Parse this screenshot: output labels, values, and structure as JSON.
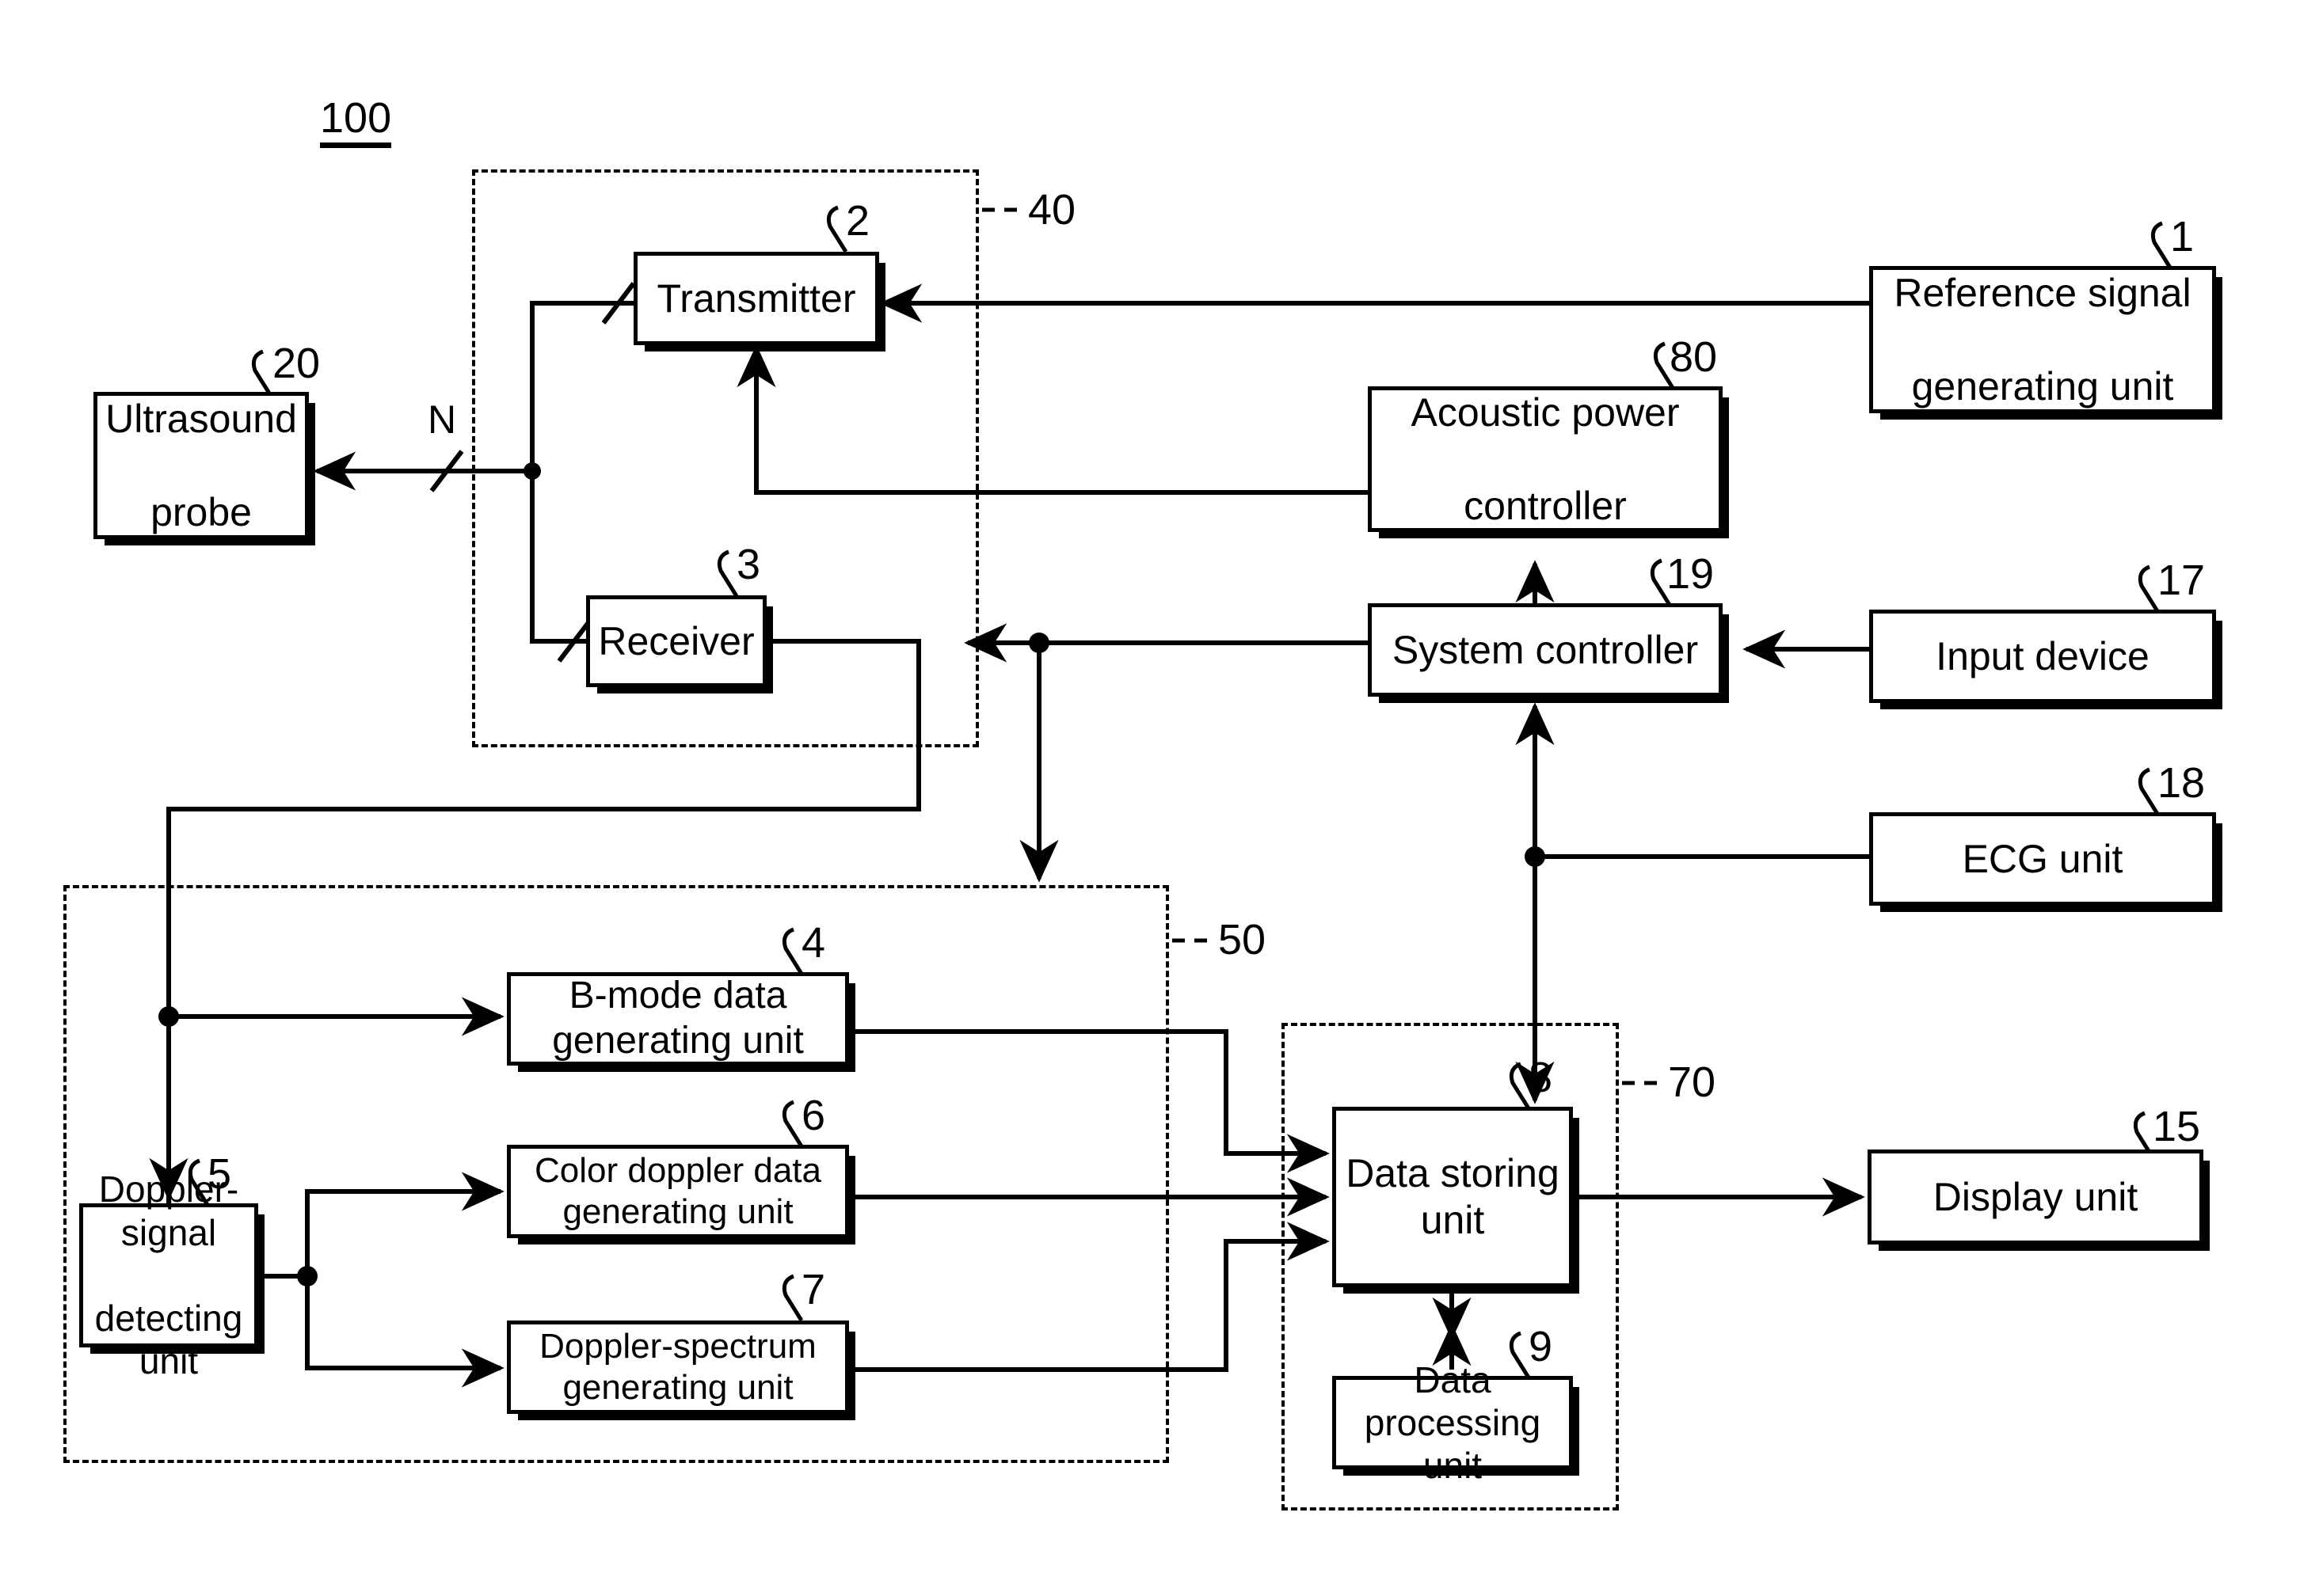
{
  "figure": {
    "system_label": "100",
    "group_labels": [
      {
        "id": "40",
        "text": "40"
      },
      {
        "id": "50",
        "text": "50"
      },
      {
        "id": "70",
        "text": "70"
      }
    ],
    "bus_label": "N"
  },
  "blocks": [
    {
      "id": "ultrasound-probe",
      "ref": "20",
      "label": "Ultrasound\nprobe",
      "line1": "Ultrasound",
      "line2": "probe"
    },
    {
      "id": "transmitter",
      "ref": "2",
      "label": "Transmitter",
      "line1": "Transmitter",
      "line2": ""
    },
    {
      "id": "receiver",
      "ref": "3",
      "label": "Receiver",
      "line1": "Receiver",
      "line2": ""
    },
    {
      "id": "reference-signal-generating",
      "ref": "1",
      "label": "Reference signal\ngenerating unit",
      "line1": "Reference signal",
      "line2": "generating unit"
    },
    {
      "id": "acoustic-power-controller",
      "ref": "80",
      "label": "Acoustic power\ncontroller",
      "line1": "Acoustic power",
      "line2": "controller"
    },
    {
      "id": "system-controller",
      "ref": "19",
      "label": "System controller",
      "line1": "System controller",
      "line2": ""
    },
    {
      "id": "input-device",
      "ref": "17",
      "label": "Input device",
      "line1": "Input device",
      "line2": ""
    },
    {
      "id": "ecg-unit",
      "ref": "18",
      "label": "ECG unit",
      "line1": "ECG unit",
      "line2": ""
    },
    {
      "id": "b-mode-data-generating",
      "ref": "4",
      "label": "B-mode data generating unit",
      "line1": "B-mode data generating unit",
      "line2": ""
    },
    {
      "id": "color-doppler-data-generating",
      "ref": "6",
      "label": "Color doppler data generating unit",
      "line1": "Color doppler data generating unit",
      "line2": ""
    },
    {
      "id": "doppler-spectrum-generating",
      "ref": "7",
      "label": "Doppler-spectrum generating unit",
      "line1": "Doppler-spectrum generating unit",
      "line2": ""
    },
    {
      "id": "doppler-signal-detecting",
      "ref": "5",
      "label": "Doppler-signal\ndetecting unit",
      "line1": "Doppler-signal",
      "line2": "detecting unit"
    },
    {
      "id": "data-storing-unit",
      "ref": "8",
      "label": "Data storing unit",
      "line1": "Data storing unit",
      "line2": ""
    },
    {
      "id": "data-processing-unit",
      "ref": "9",
      "label": "Data processing unit",
      "line1": "Data processing unit",
      "line2": ""
    },
    {
      "id": "display-unit",
      "ref": "15",
      "label": "Display unit",
      "line1": "Display unit",
      "line2": ""
    }
  ],
  "text": {
    "ultrasound_probe_l1": "Ultrasound",
    "ultrasound_probe_l2": "probe",
    "transmitter": "Transmitter",
    "receiver": "Receiver",
    "reference_signal_l1": "Reference signal",
    "reference_signal_l2": "generating unit",
    "acoustic_power_l1": "Acoustic power",
    "acoustic_power_l2": "controller",
    "system_controller": "System controller",
    "input_device": "Input device",
    "ecg_unit": "ECG unit",
    "b_mode": "B-mode data generating unit",
    "color_doppler": "Color doppler data generating unit",
    "doppler_spectrum": "Doppler-spectrum generating unit",
    "doppler_signal_l1": "Doppler-signal",
    "doppler_signal_l2": "detecting unit",
    "data_storing": "Data storing unit",
    "data_processing": "Data processing unit",
    "display_unit": "Display unit"
  },
  "refs": {
    "r1": "1",
    "r2": "2",
    "r3": "3",
    "r4": "4",
    "r5": "5",
    "r6": "6",
    "r7": "7",
    "r8": "8",
    "r9": "9",
    "r15": "15",
    "r17": "17",
    "r18": "18",
    "r19": "19",
    "r20": "20",
    "r40": "40",
    "r50": "50",
    "r70": "70",
    "r80": "80",
    "r100": "100",
    "rN": "N"
  }
}
